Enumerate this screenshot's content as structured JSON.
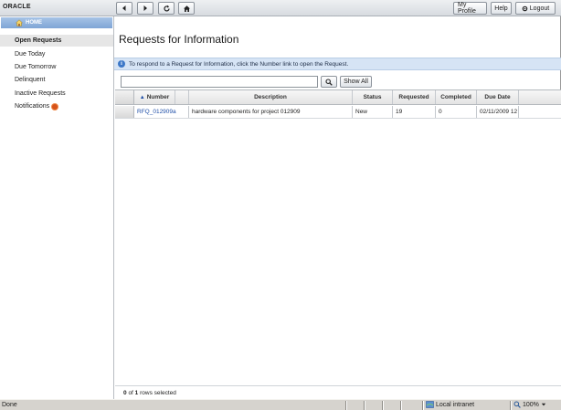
{
  "header": {
    "logo": "ORACLE",
    "nav": {
      "back_icon": "arrow-left-icon",
      "forward_icon": "arrow-right-icon",
      "refresh_icon": "refresh-icon",
      "home_icon": "home-icon"
    },
    "my_profile_label": "My Profile",
    "help_label": "Help",
    "logout_label": "Logout"
  },
  "sidebar": {
    "home_label": "HOME",
    "items": [
      {
        "label": "Open Requests",
        "active": true
      },
      {
        "label": "Due Today",
        "active": false
      },
      {
        "label": "Due Tomorrow",
        "active": false
      },
      {
        "label": "Delinquent",
        "active": false
      },
      {
        "label": "Inactive Requests",
        "active": false
      },
      {
        "label": "Notifications",
        "active": false
      }
    ]
  },
  "main": {
    "title": "Requests for Information",
    "info_message": "To respond to a Request for Information, click the Number link to open the Request.",
    "search": {
      "value": "",
      "placeholder": ""
    },
    "show_all_label": "Show All",
    "table": {
      "columns": [
        "Number",
        "Description",
        "Status",
        "Requested",
        "Completed",
        "Due Date"
      ],
      "rows": [
        {
          "number": "RFQ_012909a",
          "description": "hardware components for project 012909",
          "status": "New",
          "requested": "19",
          "completed": "0",
          "due_date": "02/11/2009 12"
        }
      ]
    },
    "selection": {
      "selected": "0",
      "of_text": "of",
      "total": "1",
      "suffix": "rows selected"
    }
  },
  "statusbar": {
    "left": "Done",
    "zone": "Local intranet",
    "zoom": "100%"
  },
  "colors": {
    "accent": "#7fa5d6",
    "info_bar": "#d6e4f5",
    "link": "#1f4fa8",
    "notification": "#d6531a"
  }
}
